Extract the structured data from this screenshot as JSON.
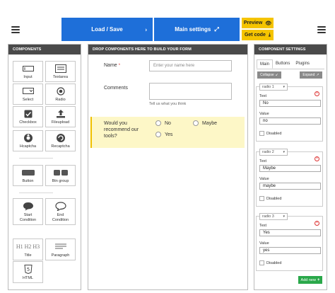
{
  "topbar": {
    "load_save": "Load / Save",
    "main_settings": "Main settings",
    "preview": "Preview",
    "get_code": "Get code"
  },
  "components": {
    "header": "COMPONENTS",
    "items": [
      "Input",
      "Textarea",
      "Select",
      "Radio",
      "Checkbox",
      "Fileupload",
      "Hcaptcha",
      "Recaptcha",
      "Button",
      "Btn group",
      "Start Condition",
      "End Condition",
      "Title",
      "Paragraph",
      "HTML"
    ],
    "title_glyph": "H1 H2 H3"
  },
  "form": {
    "header": "DROP COMPONENTS HERE TO BUILD YOUR FORM",
    "name_label": "Name",
    "required_mark": "*",
    "name_placeholder": "Enter your name here",
    "comments_label": "Comments",
    "comments_help": "Tell us what you think",
    "question": "Would you recommend our tools?",
    "options": [
      "No",
      "Maybe",
      "Yes"
    ]
  },
  "settings": {
    "header": "COMPONENT SETTINGS",
    "tabs": [
      "Main",
      "Buttons",
      "Plugins"
    ],
    "collapse": "Collapse",
    "expand": "Expand",
    "text_label": "Text",
    "value_label": "Value",
    "disabled_label": "Disabled",
    "radios": [
      {
        "name": "radio 1",
        "text": "No",
        "value": "no"
      },
      {
        "name": "radio 2",
        "text": "Maybe",
        "value": "maybe"
      },
      {
        "name": "radio 3",
        "text": "Yes",
        "value": "yes"
      }
    ],
    "add_new": "Add new"
  },
  "colors": {
    "primary": "#1e6fd9",
    "accent": "#f5c400",
    "panel_header": "#4a4a4a",
    "highlight": "#fdf7c7",
    "success": "#2aa84a",
    "danger": "#dd3333"
  }
}
